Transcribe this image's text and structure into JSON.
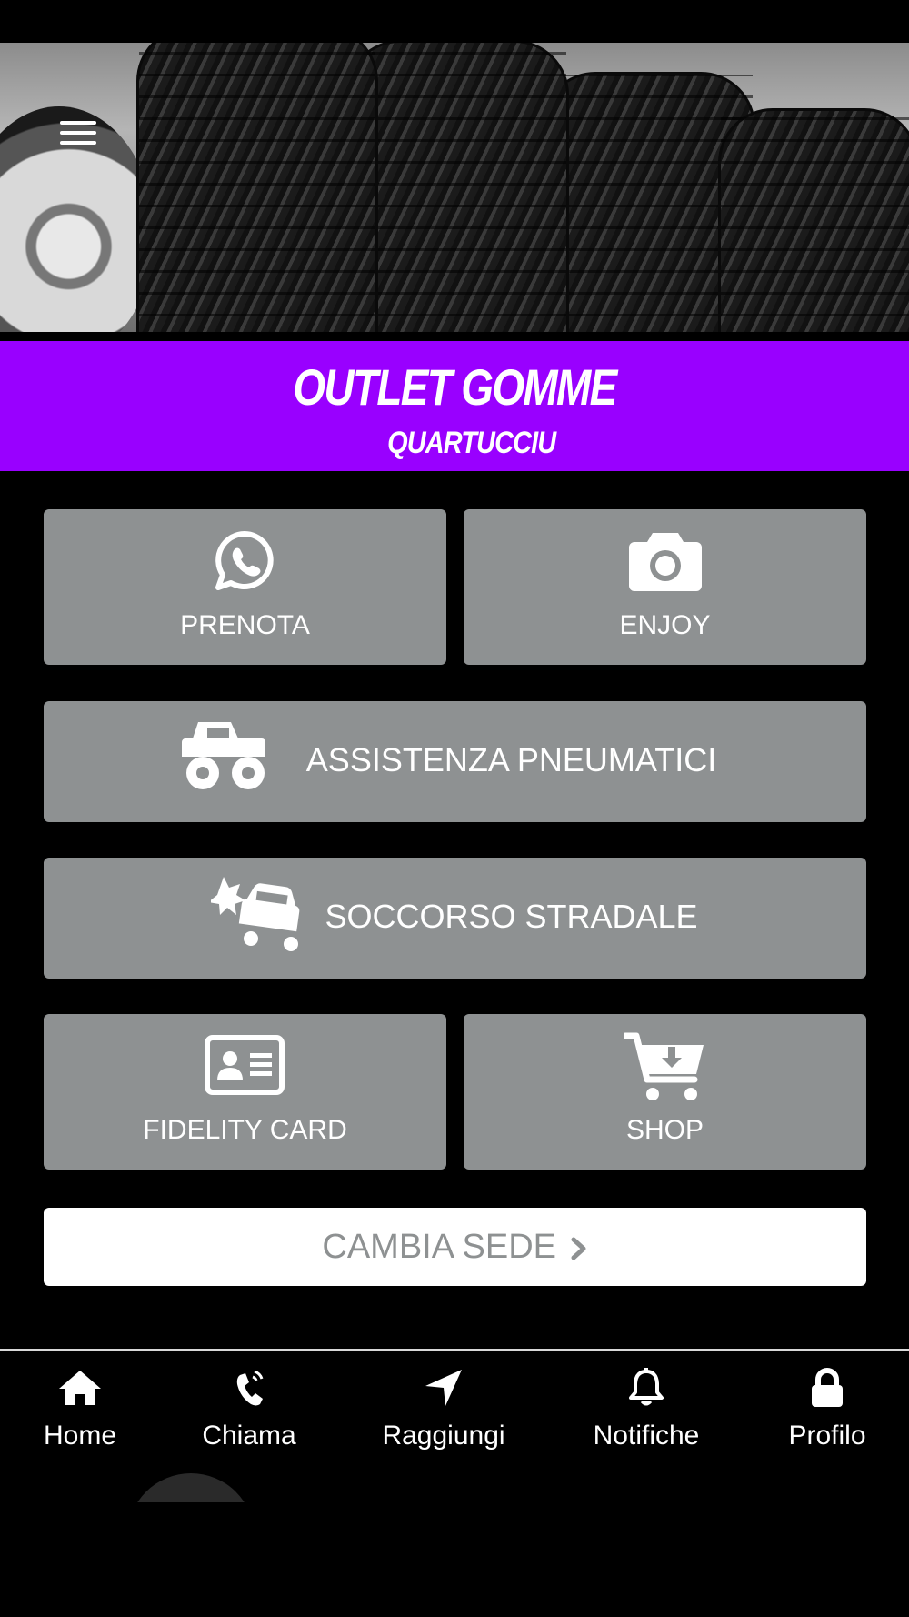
{
  "brand": {
    "title": "OUTLET GOMME",
    "subtitle": "QUARTUCCIU",
    "accent_color": "#9900ff"
  },
  "tiles": {
    "prenota": {
      "label": "PRENOTA",
      "icon": "whatsapp-icon"
    },
    "enjoy": {
      "label": "ENJOY",
      "icon": "camera-icon"
    },
    "assistenza": {
      "label": "ASSISTENZA PNEUMATICI",
      "icon": "monster-truck-icon"
    },
    "soccorso": {
      "label": "SOCCORSO STRADALE",
      "icon": "car-crash-icon"
    },
    "fidelity": {
      "label": "FIDELITY CARD",
      "icon": "id-card-icon"
    },
    "shop": {
      "label": "SHOP",
      "icon": "cart-download-icon"
    },
    "tile_color": "#8e9192"
  },
  "cambia_sede": {
    "label": "CAMBIA SEDE",
    "icon": "chevron-right-icon"
  },
  "bottom_nav": {
    "items": [
      {
        "label": "Home",
        "icon": "home-icon"
      },
      {
        "label": "Chiama",
        "icon": "phone-icon"
      },
      {
        "label": "Raggiungi",
        "icon": "location-arrow-icon"
      },
      {
        "label": "Notifiche",
        "icon": "bell-icon"
      },
      {
        "label": "Profilo",
        "icon": "lock-icon"
      }
    ]
  }
}
